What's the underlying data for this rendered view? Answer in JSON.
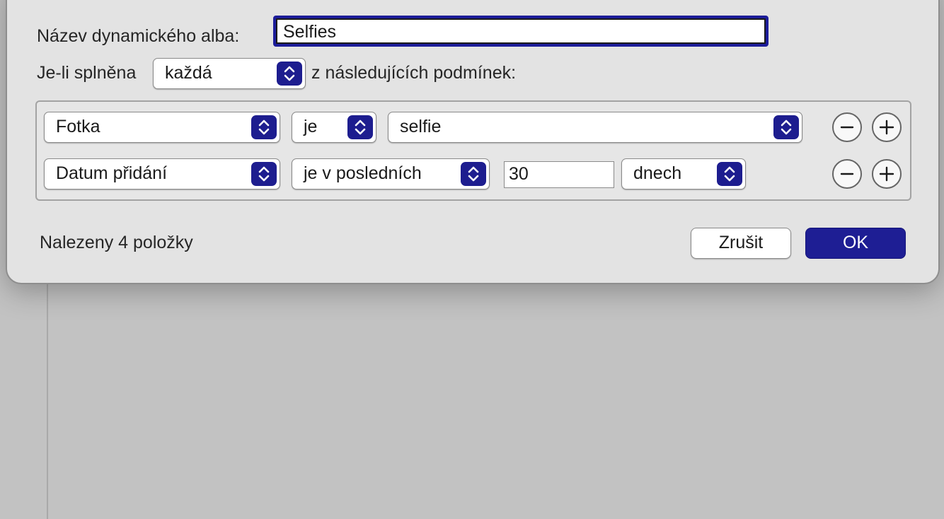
{
  "dialog": {
    "album_name_label": "Název dynamického alba:",
    "album_name_value": "Selfies",
    "condition_prefix": "Je-li splněna",
    "match_mode": "každá",
    "condition_suffix": "z následujících podmínek:"
  },
  "rules": [
    {
      "field": "Fotka",
      "operator": "je",
      "value": "selfie"
    },
    {
      "field": "Datum přidání",
      "operator": "je v posledních",
      "amount": "30",
      "unit": "dnech"
    }
  ],
  "footer": {
    "status": "Nalezeny 4 položky",
    "cancel_label": "Zrušit",
    "ok_label": "OK"
  },
  "colors": {
    "accent": "#1e1e94",
    "dialog_bg": "#e3e3e3",
    "page_bg": "#c2c2c2"
  },
  "icons": {
    "stepper": "chevron-up-down-icon",
    "remove": "minus-icon",
    "add": "plus-icon"
  }
}
